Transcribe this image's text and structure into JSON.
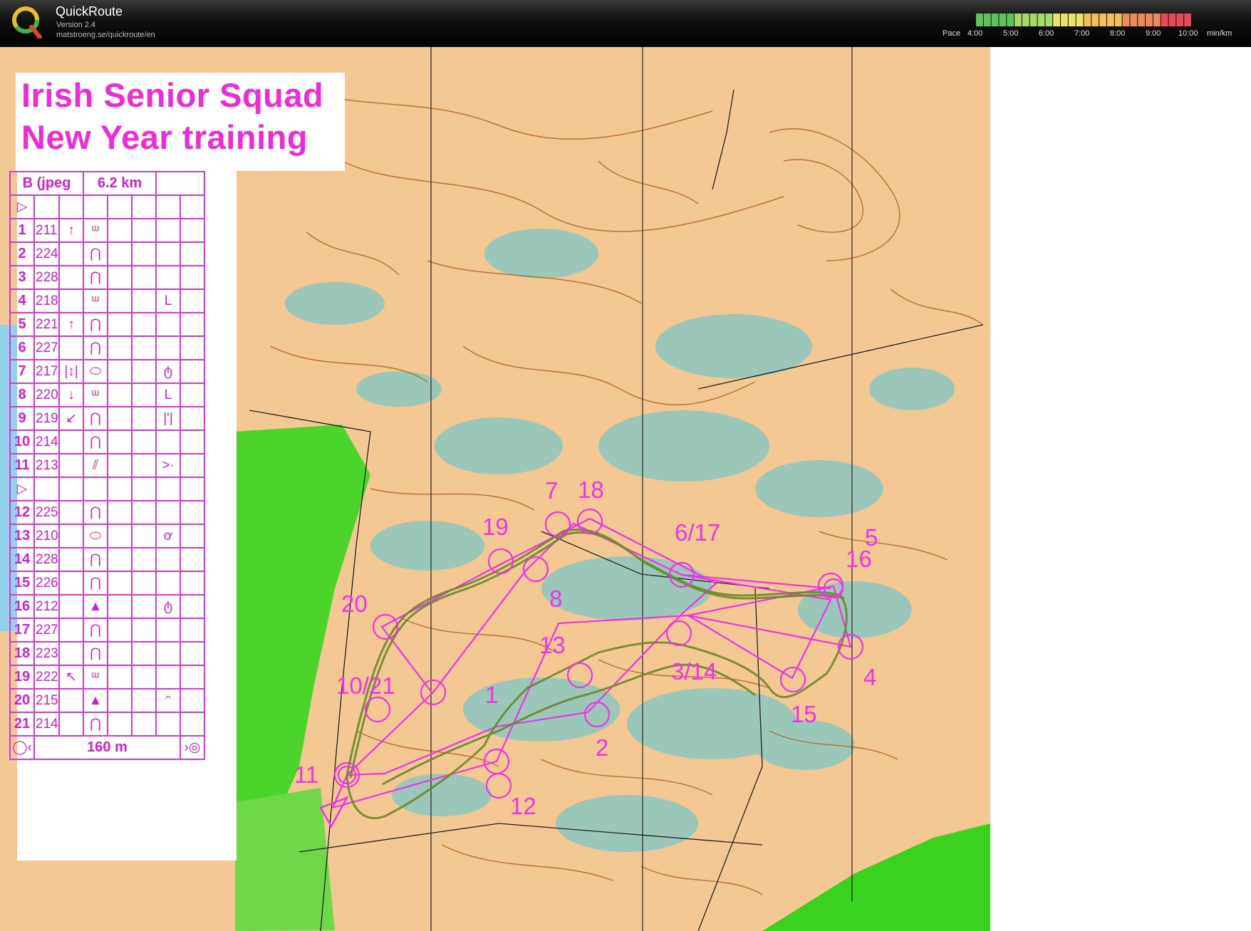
{
  "app": {
    "name": "QuickRoute",
    "version": "Version 2.4",
    "url": "matstroeng.se/quickroute/en"
  },
  "pace_scale": {
    "label": "Pace",
    "ticks": [
      "4:00",
      "5:00",
      "6:00",
      "7:00",
      "8:00",
      "9:00",
      "10:00"
    ],
    "unit": "min/km",
    "colors": [
      "#5fc15f",
      "#a7d86a",
      "#e8e46a",
      "#f0c05a",
      "#f08a5a",
      "#e84a5a"
    ]
  },
  "map": {
    "title_line1": "Irish Senior Squad",
    "title_line2": "New Year training",
    "colors": {
      "open": "#f4c892",
      "forest_green": "#3ad21f",
      "marsh": "#7cc7c5",
      "course": "#ee34e6",
      "contour": "#b5651d",
      "route": "#6b8a2a"
    },
    "control_labels": [
      "1",
      "2",
      "3/14",
      "4",
      "5",
      "6/17",
      "7",
      "8",
      "10/21",
      "11",
      "12",
      "13",
      "15",
      "16",
      "18",
      "19",
      "20"
    ]
  },
  "description_sheet": {
    "course": "B (jpeg",
    "length": "6.2 km",
    "rows": [
      {
        "num": "1",
        "code": "211",
        "dir": "↑",
        "feature": "ᵚ",
        "extra": ""
      },
      {
        "num": "2",
        "code": "224",
        "dir": "",
        "feature": "⋂",
        "extra": ""
      },
      {
        "num": "3",
        "code": "228",
        "dir": "",
        "feature": "⋂",
        "extra": ""
      },
      {
        "num": "4",
        "code": "218",
        "dir": "",
        "feature": "ᵚ",
        "extra": "L"
      },
      {
        "num": "5",
        "code": "221",
        "dir": "↑",
        "feature": "⋂",
        "extra": ""
      },
      {
        "num": "6",
        "code": "227",
        "dir": "",
        "feature": "⋂",
        "extra": ""
      },
      {
        "num": "7",
        "code": "217",
        "dir": "|↕|",
        "feature": "⬭",
        "extra": "ტ"
      },
      {
        "num": "8",
        "code": "220",
        "dir": "↓",
        "feature": "ᵚ",
        "extra": "L"
      },
      {
        "num": "9",
        "code": "219",
        "dir": "↙",
        "feature": "⋂",
        "extra": "|'|"
      },
      {
        "num": "10",
        "code": "214",
        "dir": "",
        "feature": "⋂",
        "extra": ""
      },
      {
        "num": "11",
        "code": "213",
        "dir": "",
        "feature": "⫽",
        "extra": ">·"
      },
      {
        "num": "12",
        "code": "225",
        "dir": "",
        "feature": "⋂",
        "extra": ""
      },
      {
        "num": "13",
        "code": "210",
        "dir": "",
        "feature": "⬭",
        "extra": "ơ"
      },
      {
        "num": "14",
        "code": "228",
        "dir": "",
        "feature": "⋂",
        "extra": ""
      },
      {
        "num": "15",
        "code": "226",
        "dir": "",
        "feature": "⋂",
        "extra": ""
      },
      {
        "num": "16",
        "code": "212",
        "dir": "",
        "feature": "▲",
        "extra": "ტ"
      },
      {
        "num": "17",
        "code": "227",
        "dir": "",
        "feature": "⋂",
        "extra": ""
      },
      {
        "num": "18",
        "code": "223",
        "dir": "",
        "feature": "⋂",
        "extra": ""
      },
      {
        "num": "19",
        "code": "222",
        "dir": "↖",
        "feature": "ᵚ",
        "extra": ""
      },
      {
        "num": "20",
        "code": "215",
        "dir": "",
        "feature": "▲",
        "extra": "ᵔ"
      },
      {
        "num": "21",
        "code": "214",
        "dir": "",
        "feature": "⋂",
        "extra": ""
      }
    ],
    "finish_distance": "160 m"
  }
}
